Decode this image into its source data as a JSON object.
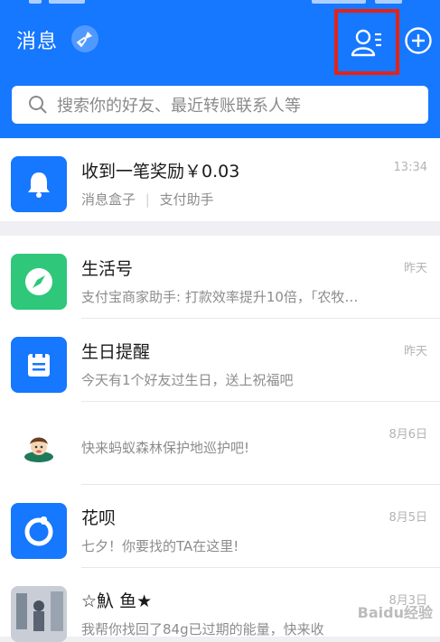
{
  "header": {
    "title": "消息",
    "search_placeholder": "搜索你的好友、最近转账联系人等"
  },
  "colors": {
    "brand": "#1677ff",
    "highlight": "#e2231a"
  },
  "messages": [
    {
      "name": "收到一笔奖励￥0.03",
      "sub_parts": [
        "消息盒子",
        "支付助手"
      ],
      "time": "13:34",
      "icon": "bell-icon"
    },
    {
      "name": "生活号",
      "sub": "支付宝商家助手: 打款效率提升10倍，「农牧…",
      "time": "昨天",
      "icon": "compass-icon"
    },
    {
      "name": "生日提醒",
      "sub": "今天有1个好友过生日，送上祝福吧",
      "time": "昨天",
      "icon": "calendar-icon"
    },
    {
      "name": "",
      "sub": "快来蚂蚁森林保护地巡护吧!",
      "time": "8月6日",
      "icon": "forest-character-icon"
    },
    {
      "name": "花呗",
      "sub": "七夕！你要找的TA在这里!",
      "time": "8月5日",
      "icon": "huabei-icon"
    },
    {
      "name": "☆魞 鱼★",
      "sub": "我帮你找回了84g已过期的能量，快来收",
      "time": "8月3日",
      "icon": "photo-avatar"
    }
  ],
  "watermark": "Baidu经验"
}
